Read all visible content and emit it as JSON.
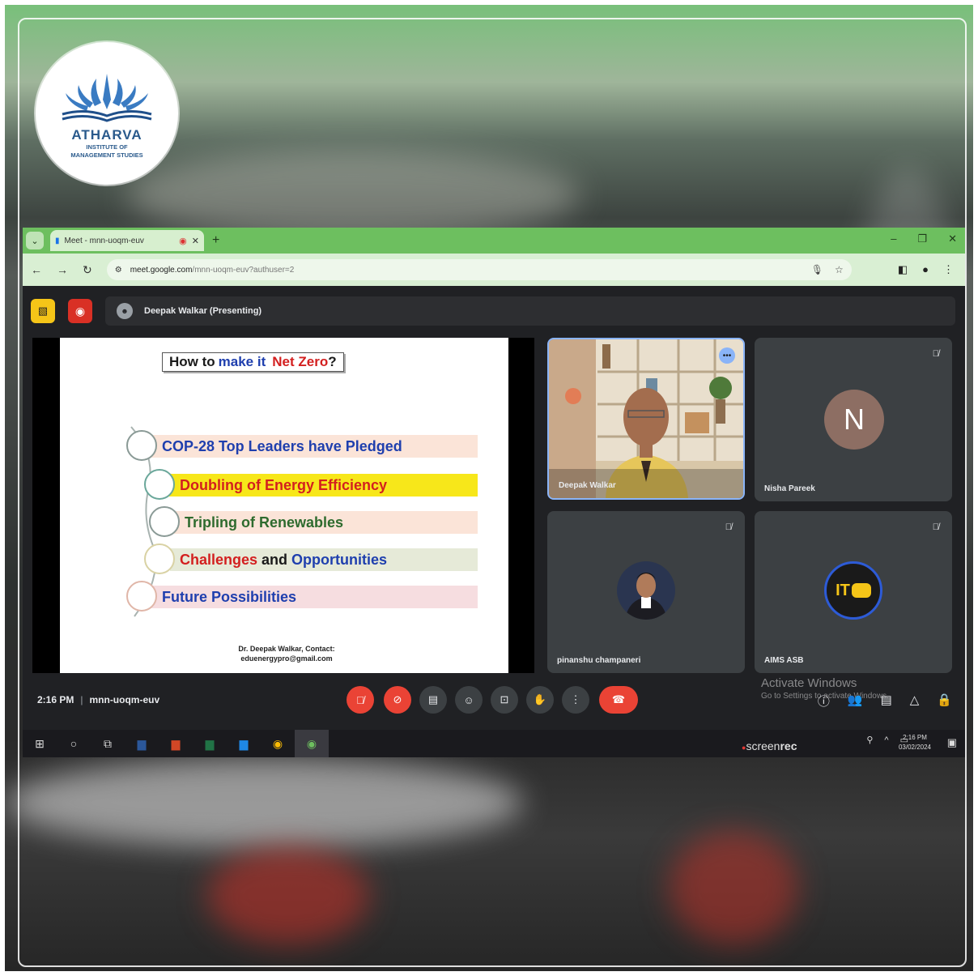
{
  "logo": {
    "name": "ATHARVA",
    "sub1": "INSTITUTE OF",
    "sub2": "MANAGEMENT STUDIES"
  },
  "browser": {
    "tab_title": "Meet - mnn-uoqm-euv",
    "url_host": "meet.google.com",
    "url_path": "/mnn-uoqm-euv?authuser=2"
  },
  "meet": {
    "presenting_label": "Deepak Walkar (Presenting)",
    "slide": {
      "title_part1": "How to",
      "title_part2": "make it",
      "title_part3": "Net Zero",
      "title_part4": "?",
      "items": [
        {
          "text": "COP-28 Top Leaders have Pledged",
          "color": "#1f3fae",
          "band": "#fbe4d8"
        },
        {
          "text": "Doubling of Energy Efficiency",
          "color": "#d31f1f",
          "band": "#f7e71a"
        },
        {
          "text": "Tripling of Renewables",
          "color": "#2e6b2e",
          "band": "#fbe4d8"
        },
        {
          "challenges": "Challenges",
          "and": "and",
          "opportunities": "Opportunities",
          "band": "#e6ead8"
        },
        {
          "text": "Future Possibilities",
          "color": "#1f3fae",
          "band": "#f6dde0"
        }
      ],
      "footer_line1": "Dr. Deepak Walkar, Contact:",
      "footer_line2": "eduenergypro@gmail.com"
    },
    "participants": [
      {
        "name": "Deepak Walkar"
      },
      {
        "name": "Nisha Pareek",
        "initial": "N"
      },
      {
        "name": "pinanshu champaneri"
      },
      {
        "name": "AIMS ASB",
        "logo_text": "IT"
      }
    ],
    "time": "2:16 PM",
    "meeting_code": "mnn-uoqm-euv",
    "activate_line1": "Activate Windows",
    "activate_line2": "Go to Settings to activate Windows."
  },
  "taskbar": {
    "recorder": "screen",
    "recorder_bold": "rec",
    "clock_time": "2:16 PM",
    "clock_date": "03/02/2024"
  },
  "colors": {
    "meet_bg": "#202124",
    "tile_bg": "#3c4043",
    "end_call": "#ea4335",
    "browser_accent": "#6dbf5f"
  }
}
